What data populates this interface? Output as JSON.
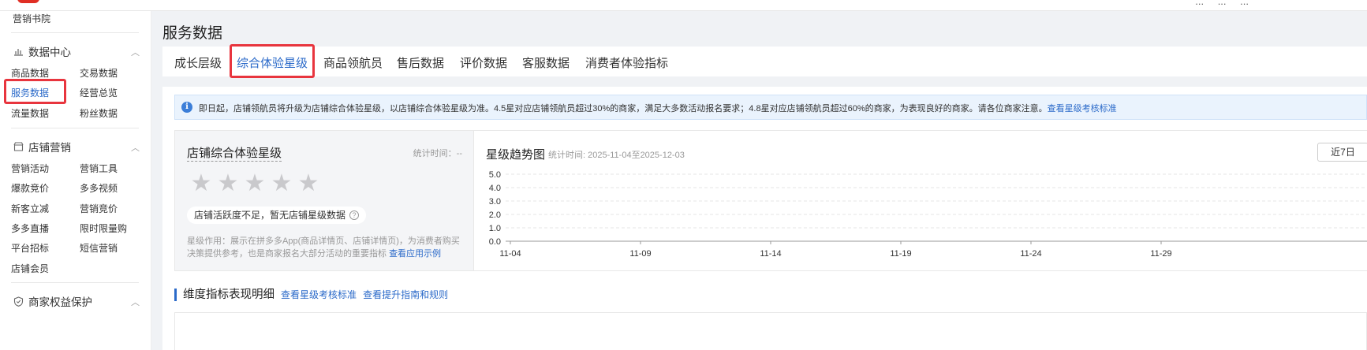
{
  "header": {
    "links": [
      "...",
      "...",
      "..."
    ]
  },
  "sidebar": {
    "top_item": "营销书院",
    "groups": [
      {
        "title": "数据中心",
        "icon": "bar-chart-icon",
        "items": [
          "商品数据",
          "交易数据",
          "服务数据",
          "经营总览",
          "流量数据",
          "粉丝数据"
        ]
      },
      {
        "title": "店铺营销",
        "icon": "shop-icon",
        "items": [
          "营销活动",
          "营销工具",
          "爆款竞价",
          "多多视频",
          "新客立减",
          "营销竞价",
          "多多直播",
          "限时限量购",
          "平台招标",
          "短信营销",
          "店铺会员"
        ]
      },
      {
        "title": "商家权益保护",
        "icon": "shield-icon",
        "items": []
      }
    ],
    "active_item": "服务数据"
  },
  "page": {
    "title": "服务数据"
  },
  "tabs": [
    "成长层级",
    "综合体验星级",
    "商品领航员",
    "售后数据",
    "评价数据",
    "客服数据",
    "消费者体验指标"
  ],
  "active_tab": "综合体验星级",
  "notice": {
    "text": "即日起，店铺领航员将升级为店铺综合体验星级，以店铺综合体验星级为准。4.5星对应店铺领航员超过30%的商家，满足大多数活动报名要求；4.8星对应店铺领航员超过60%的商家，为表现良好的商家。请各位商家注意。",
    "link": "查看星级考核标准"
  },
  "star_card": {
    "title": "店铺综合体验星级",
    "stat_time": "统计时间：--",
    "stars_filled": 0,
    "stars_total": 5,
    "status": "店铺活跃度不足，暂无店铺星级数据",
    "desc": "星级作用：展示在拼多多App(商品详情页、店铺详情页)，为消费者购买决策提供参考，也是商家报名大部分活动的重要指标",
    "desc_link": "查看应用示例"
  },
  "trend": {
    "title": "星级趋势图",
    "range": "统计时间: 2025-11-04至2025-12-03",
    "btn_7d": "近7日",
    "btn_next": "近"
  },
  "chart_data": {
    "type": "line",
    "title": "星级趋势图",
    "x": [
      "11-04",
      "11-09",
      "11-14",
      "11-19",
      "11-24",
      "11-29"
    ],
    "series": [],
    "ylim": [
      0,
      5
    ],
    "yticks": [
      "5.0",
      "4.0",
      "3.0",
      "2.0",
      "1.0",
      "0.0"
    ],
    "grid": true
  },
  "section": {
    "title": "维度指标表现明细",
    "link1": "查看星级考核标准",
    "link2": "查看提升指南和规则"
  },
  "colors": {
    "accent": "#2b6ac9",
    "highlight": "#e8353e",
    "star_empty": "#c9c9cc"
  }
}
